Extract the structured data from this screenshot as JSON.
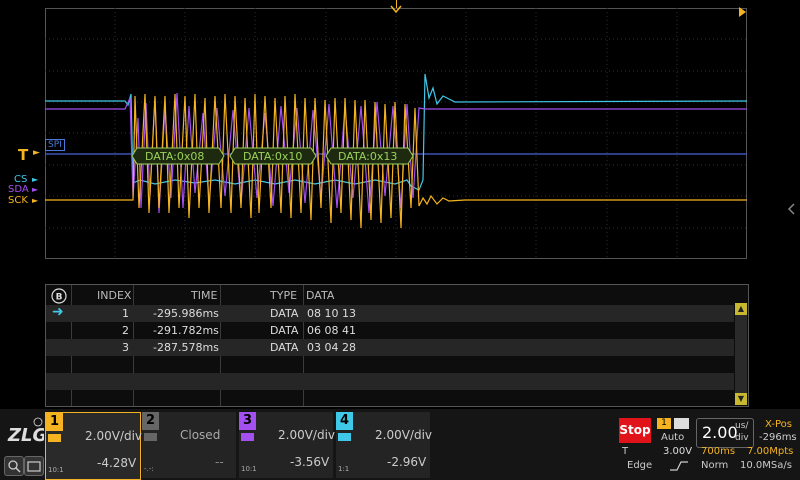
{
  "trigger": {
    "marker_label": "T"
  },
  "protocol": {
    "label": "SPI"
  },
  "channels_labels": [
    "CS",
    "SDA",
    "SCK"
  ],
  "decode_frames": [
    "DATA:0x08",
    "DATA:0x10",
    "DATA:0x13"
  ],
  "table": {
    "headers": {
      "index": "INDEX",
      "time": "TIME",
      "type": "TYPE",
      "data": "DATA"
    },
    "rows": [
      {
        "index": "1",
        "time": "-295.986ms",
        "type": "DATA",
        "data": "08 10 13"
      },
      {
        "index": "2",
        "time": "-291.782ms",
        "type": "DATA",
        "data": "06 08 41"
      },
      {
        "index": "3",
        "time": "-287.578ms",
        "type": "DATA",
        "data": "03 04 28"
      }
    ]
  },
  "channels": [
    {
      "num": "1",
      "scale": "2.00V/div",
      "offset": "-4.28V",
      "probe": "10:1",
      "color": "#f5b321"
    },
    {
      "num": "2",
      "status": "Closed",
      "offset": "--",
      "probe": "-.-:",
      "color": "#666666"
    },
    {
      "num": "3",
      "scale": "2.00V/div",
      "offset": "-3.56V",
      "probe": "10:1",
      "color": "#a44ff0"
    },
    {
      "num": "4",
      "scale": "2.00V/div",
      "offset": "-2.96V",
      "probe": "1:1",
      "color": "#3fc8e8"
    }
  ],
  "acquisition": {
    "run_state": "Stop",
    "trigger_source": "1",
    "trigger_mode": "Auto",
    "trigger_label": "T",
    "trigger_level": "3.00V",
    "trigger_type": "Edge",
    "timebase_value": "2.00",
    "timebase_unit_top": "us/",
    "timebase_unit_bottom": "div",
    "xpos_label": "X-Pos",
    "xpos_value": "-296ms",
    "memory_time": "700ms",
    "memory_depth": "7.00Mpts",
    "acq_mode": "Norm",
    "sample_rate": "10.0MSa/s"
  },
  "colors": {
    "ch1": "#f5b321",
    "ch3": "#a44ff0",
    "ch4": "#3fc8e8",
    "protocol": "#4a7ad8",
    "decode": "#9bd15a",
    "stop": "#e0121a"
  }
}
